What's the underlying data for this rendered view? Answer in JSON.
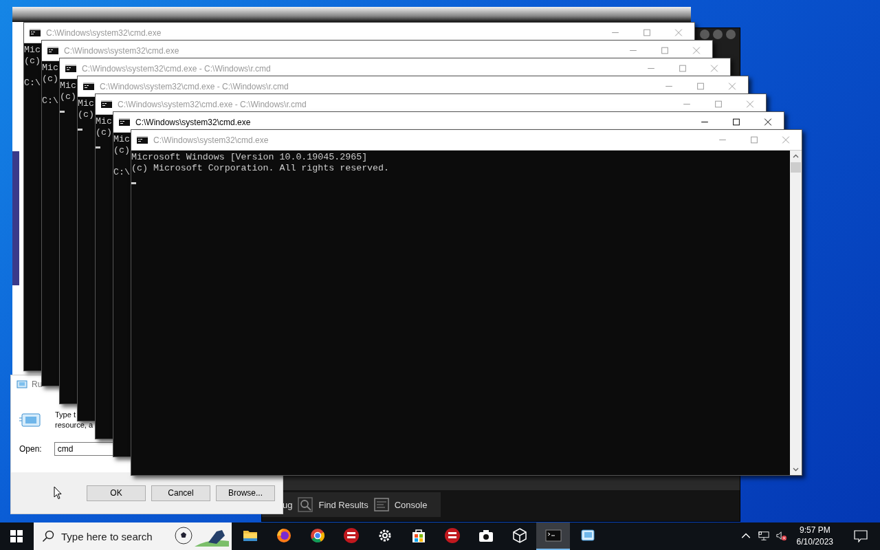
{
  "cmd_windows": [
    {
      "title": "C:\\Windows\\system32\\cmd.exe",
      "active": false,
      "lines": [
        "Mic",
        "(c)"
      ],
      "cursor": false,
      "prompt": "C:\\"
    },
    {
      "title": "C:\\Windows\\system32\\cmd.exe",
      "active": false,
      "lines": [
        "Mic",
        "(c)"
      ],
      "cursor": false,
      "prompt": "C:\\"
    },
    {
      "title": "C:\\Windows\\system32\\cmd.exe - C:\\Windows\\r.cmd",
      "active": false,
      "lines": [
        "Mic",
        "(c)"
      ],
      "cursor": true
    },
    {
      "title": "C:\\Windows\\system32\\cmd.exe - C:\\Windows\\r.cmd",
      "active": false,
      "lines": [
        "Mic",
        "(c)"
      ],
      "cursor": true
    },
    {
      "title": "C:\\Windows\\system32\\cmd.exe - C:\\Windows\\r.cmd",
      "active": false,
      "lines": [
        "Mic",
        "(c)"
      ],
      "cursor": true
    },
    {
      "title": "C:\\Windows\\system32\\cmd.exe",
      "active": true,
      "lines": [
        "Mic",
        "(c)"
      ],
      "cursor": false,
      "prompt": "C:\\"
    },
    {
      "title": "C:\\Windows\\system32\\cmd.exe",
      "active": false,
      "lines": [
        "Microsoft Windows [Version 10.0.19045.2965]",
        "(c) Microsoft Corporation. All rights reserved."
      ],
      "cursor": true
    }
  ],
  "run_dialog": {
    "title": "Ru",
    "description_lines": [
      "Type t",
      "resource, a"
    ],
    "open_label": "Open:",
    "open_value": "cmd",
    "buttons": [
      "OK",
      "Cancel",
      "Browse..."
    ]
  },
  "ide_window": {
    "tabs": [
      {
        "kind": "text",
        "label": "ug"
      },
      {
        "kind": "search",
        "label": "Find Results"
      },
      {
        "kind": "console",
        "label": "Console"
      }
    ]
  },
  "taskbar": {
    "search_placeholder": "Type here to search",
    "apps": [
      {
        "kind": "folder",
        "active": false
      },
      {
        "kind": "firefox",
        "active": false
      },
      {
        "kind": "chrome",
        "active": false
      },
      {
        "kind": "devcpp",
        "active": false
      },
      {
        "kind": "settings",
        "active": false
      },
      {
        "kind": "store",
        "active": false
      },
      {
        "kind": "devcpp",
        "active": false
      },
      {
        "kind": "camera",
        "active": false
      },
      {
        "kind": "cube",
        "active": false
      },
      {
        "kind": "terminal",
        "active": true
      },
      {
        "kind": "run",
        "active": false
      }
    ],
    "time": "9:57 PM",
    "date": "6/10/2023"
  }
}
